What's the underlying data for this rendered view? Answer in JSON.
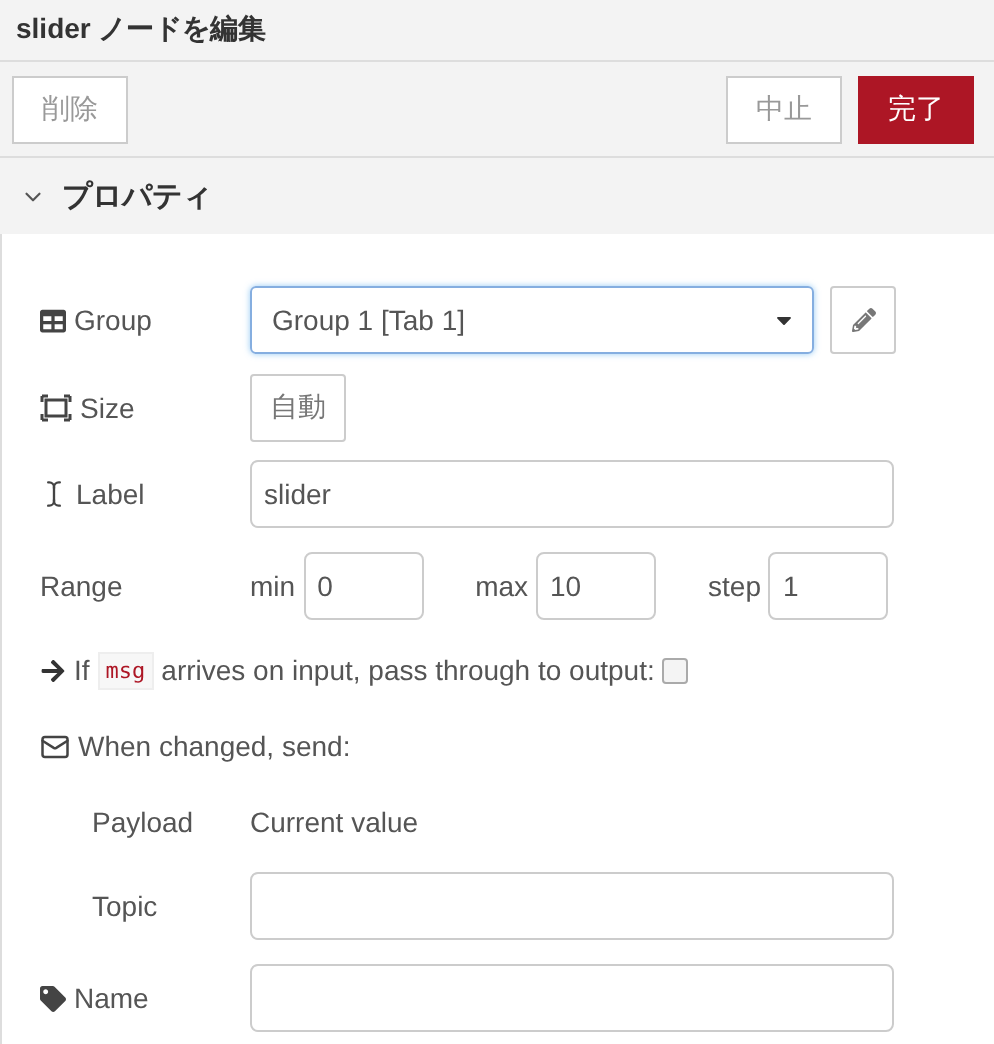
{
  "header": {
    "title": "slider ノードを編集"
  },
  "toolbar": {
    "buttons": [
      {
        "label": "削除",
        "kind": "secondary"
      },
      {
        "label": "中止",
        "kind": "secondary"
      },
      {
        "label": "完了",
        "kind": "primary"
      }
    ]
  },
  "section": {
    "title": "プロパティ",
    "expanded": true
  },
  "rows": [
    {
      "kind": "select",
      "label": "Group",
      "value": "Group 1 [Tab 1]",
      "focused": true
    },
    {
      "kind": "size",
      "label": "Size",
      "value": "自動"
    },
    {
      "kind": "text",
      "label": "Label",
      "value": "slider"
    },
    {
      "kind": "range",
      "label": "Range",
      "parts": [
        {
          "label": "min",
          "value": "0"
        },
        {
          "label": "max",
          "value": "10"
        },
        {
          "label": "step",
          "value": "1"
        }
      ]
    },
    {
      "kind": "check",
      "before": "If",
      "code": "msg",
      "after": "arrives on input, pass through to output:",
      "checked": false
    },
    {
      "kind": "heading",
      "label": "When changed, send:"
    },
    {
      "kind": "static",
      "label": "Payload",
      "value": "Current value",
      "indent": true
    },
    {
      "kind": "text",
      "label": "Topic",
      "value": "",
      "indent": true
    },
    {
      "kind": "text",
      "label": "Name",
      "value": ""
    }
  ]
}
